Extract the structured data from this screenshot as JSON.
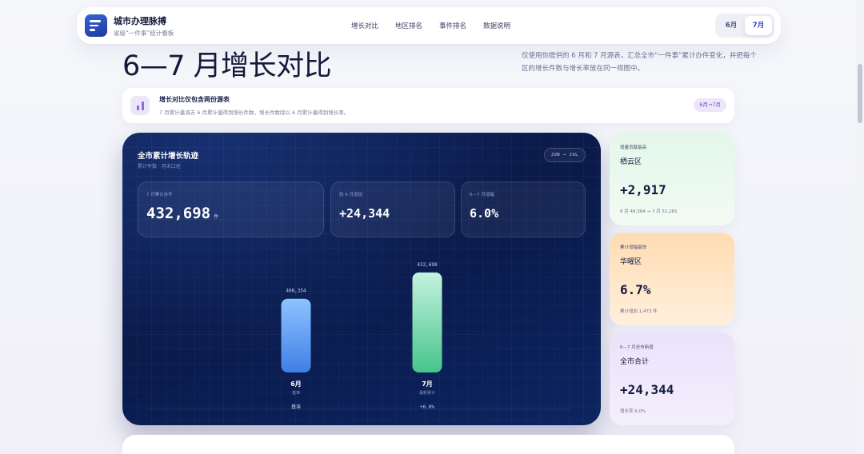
{
  "nav": {
    "title": "城市办理脉搏",
    "subtitle": "省级“一件事”统计看板",
    "links": [
      "增长对比",
      "地区排名",
      "事件排名",
      "数据说明"
    ],
    "months": [
      "6月",
      "7月"
    ],
    "active_month": "7月"
  },
  "hero": {
    "title": "6—7 月增长对比",
    "description": "仅使用你提供的 6 月和 7 月源表，汇总全市“一件事”累计办件变化，并把每个区的增长件数与增长率放在同一视图中。"
  },
  "notice": {
    "title": "增长对比仅包含两份源表",
    "text": "7 月累计量减去 6 月累计量得到增长件数，增长件数除以 6 月累计量得到增长率。",
    "tag": "6月→7月"
  },
  "panel": {
    "title": "全市累计增长轨迹",
    "subtitle": "累计件数 · 月末口径",
    "badge": "JUN → JUL",
    "stats": [
      {
        "label": "7 月累计办件",
        "value": "432,698",
        "unit": "件"
      },
      {
        "label": "较 6 月增加",
        "value": "+24,344",
        "unit": ""
      },
      {
        "label": "6—7 月增幅",
        "value": "6.0%",
        "unit": ""
      }
    ],
    "footer_left": "基准",
    "footer_right": "+6.0%"
  },
  "chart_data": {
    "type": "bar",
    "categories": [
      "6月",
      "7月"
    ],
    "category_notes": [
      "基准",
      "最新累计"
    ],
    "values": [
      408354,
      432698
    ],
    "value_labels": [
      "408,354",
      "432,698"
    ],
    "ylim": [
      340000,
      440000
    ],
    "colors": [
      "#5b9cf2",
      "#5fd3a0"
    ]
  },
  "cards": [
    {
      "kicker": "增量贡献最高",
      "name": "栖云区",
      "value": "+2,917",
      "foot": "6 月 49,364 → 7 月 52,281"
    },
    {
      "kicker": "累计增幅最快",
      "name": "华曜区",
      "value": "6.7%",
      "foot": "累计增加 1,473 件"
    },
    {
      "kicker": "6—7 月全市新增",
      "name": "全市合计",
      "value": "+24,344",
      "foot": "增长率 6.0%"
    }
  ]
}
